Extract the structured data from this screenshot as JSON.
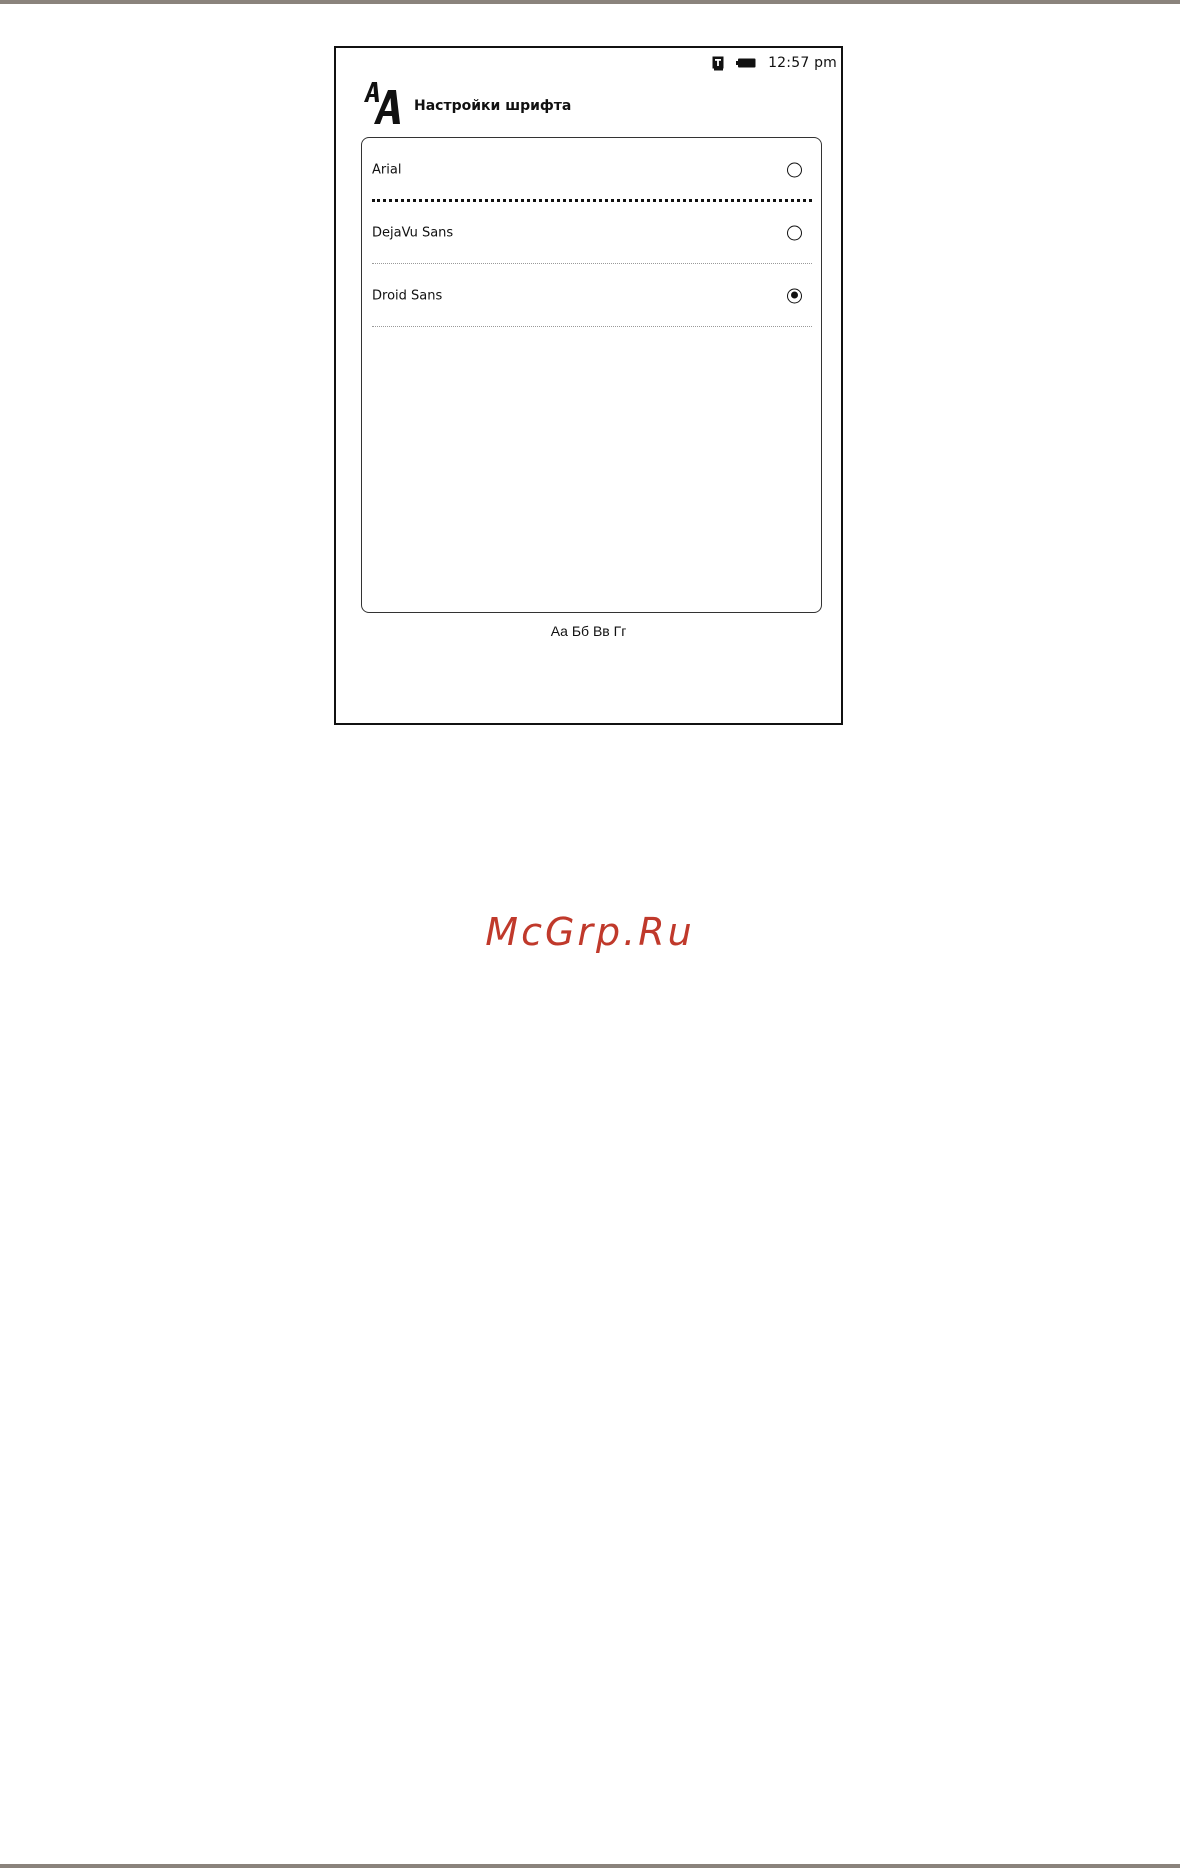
{
  "status_bar": {
    "time": "12:57 pm",
    "icons": [
      "book-store-icon",
      "battery-icon"
    ]
  },
  "header": {
    "icon": "font-size-aa-icon",
    "title": "Настройки шрифта"
  },
  "font_list": {
    "items": [
      {
        "label": "Arial",
        "selected": false,
        "focused": true
      },
      {
        "label": "DejaVu Sans",
        "selected": false,
        "focused": false
      },
      {
        "label": "Droid Sans",
        "selected": true,
        "focused": false
      }
    ]
  },
  "preview": {
    "text": "Аа Бб Вв Гг"
  },
  "watermark": {
    "text": "McGrp.Ru",
    "color": "#c0392b"
  }
}
